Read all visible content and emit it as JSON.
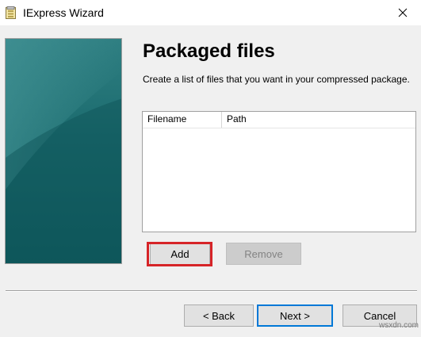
{
  "window": {
    "title": "IExpress Wizard",
    "app_icon": "iexpress-package-icon",
    "close_icon": "close-icon"
  },
  "page": {
    "title": "Packaged files",
    "description": "Create a list of files that you want in your compressed package."
  },
  "file_list": {
    "columns": [
      "Filename",
      "Path"
    ],
    "rows": []
  },
  "buttons": {
    "add": "Add",
    "remove": "Remove",
    "back": "< Back",
    "next": "Next >",
    "cancel": "Cancel"
  },
  "annotation": {
    "highlight_color": "#d62428"
  },
  "watermark": "wsxdn.com",
  "colors": {
    "side_panel_teal": "#1a6a6d",
    "focus_border": "#0078d7"
  }
}
